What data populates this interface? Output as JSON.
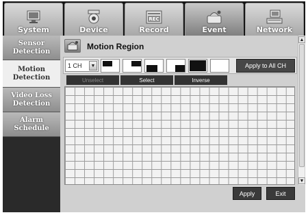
{
  "nav": {
    "tabs": [
      {
        "label": "System",
        "icon": "monitor-icon"
      },
      {
        "label": "Device",
        "icon": "camera-icon"
      },
      {
        "label": "Record",
        "icon": "rec-icon"
      },
      {
        "label": "Event",
        "icon": "alarm-icon"
      },
      {
        "label": "Network",
        "icon": "network-icon"
      }
    ],
    "active_tab": "Event"
  },
  "sidebar": {
    "items": [
      {
        "label": "Sensor Detection"
      },
      {
        "label": "Motion Detection"
      },
      {
        "label": "Video Loss Detection"
      },
      {
        "label": "Alarm Schedule"
      }
    ],
    "active_item": "Motion Detection"
  },
  "main": {
    "title": "Motion Region",
    "title_icon": "motion-region-icon",
    "channel_select": {
      "value": "1 CH"
    },
    "apply_all_label": "Apply to All CH",
    "selection_buttons": {
      "unselect": "Unselect",
      "select": "Select",
      "inverse": "Inverse"
    },
    "apply_label": "Apply",
    "exit_label": "Exit"
  }
}
